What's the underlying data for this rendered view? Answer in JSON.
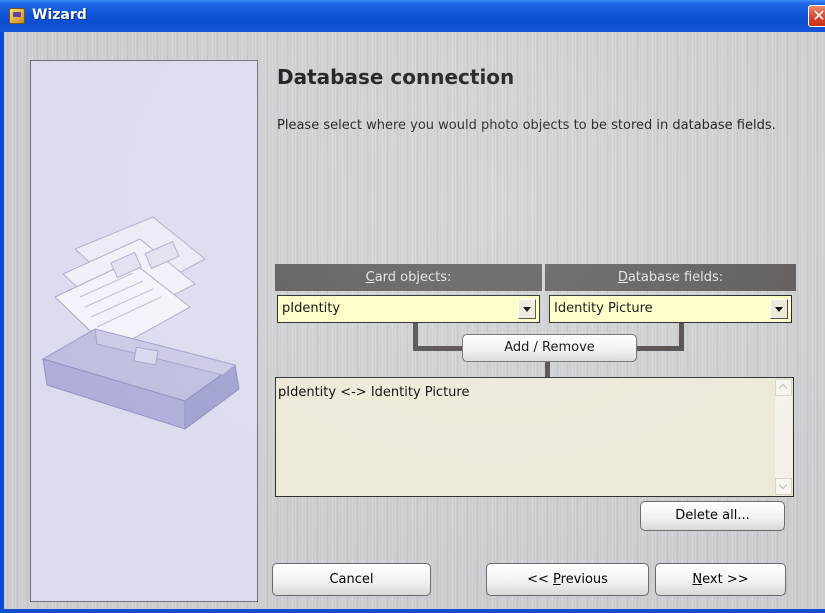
{
  "window": {
    "title": "Wizard",
    "close_glyph": "✕"
  },
  "page": {
    "title": "Database connection",
    "description": "Please select where you would photo objects to be stored in database fields."
  },
  "mapping": {
    "card_objects_header": "Card objects:",
    "card_objects_accesskey": "C",
    "card_objects_header_rest": "ard objects:",
    "database_fields_accesskey": "D",
    "database_fields_header_rest": "atabase fields:",
    "card_object_selected": "pIdentity",
    "database_field_selected": "Identity Picture",
    "add_remove_label": "Add / Remove",
    "mappings": [
      "pIdentity <-> Identity Picture"
    ],
    "delete_all_label": "Delete all..."
  },
  "nav": {
    "cancel_label": "Cancel",
    "previous_prefix": "<< ",
    "previous_accesskey": "P",
    "previous_rest": "revious",
    "next_accesskey": "N",
    "next_rest": "ext >>"
  },
  "icons": {
    "app": "wizard-app-icon",
    "close": "close-icon",
    "illustration": "card-file-box-illustration",
    "dropdown": "chevron-down-icon"
  },
  "colors": {
    "titlebar": "#0c4ecf",
    "header_bg": "#5c5757",
    "combo_bg": "#ffffc4",
    "side_panel": "#dcdcf0"
  }
}
